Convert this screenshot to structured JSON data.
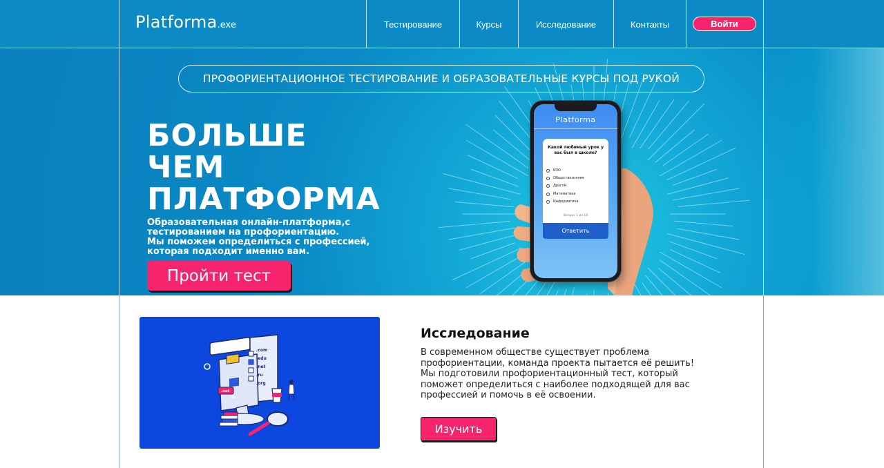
{
  "header": {
    "logo_main": "Platforma",
    "logo_suffix": ".exe",
    "nav": [
      {
        "label": "Тестирование"
      },
      {
        "label": "Курсы"
      },
      {
        "label": "Исследование"
      },
      {
        "label": "Контакты"
      }
    ],
    "login_label": "Войти"
  },
  "hero": {
    "pill_text": "ПРОФОРИЕНТАЦИОННОЕ ТЕСТИРОВАНИЕ И ОБРАЗОВАТЕЛЬНЫЕ КУРСЫ ПОД РУКОЙ",
    "headline": [
      "БОЛЬШЕ",
      "ЧЕМ",
      "ПЛАТФОРМА"
    ],
    "description": [
      "Образовательная онлайн-платформа,с",
      "тестированием на профориентацию.",
      "Мы поможем определиться с профессией,",
      "которая подходит именно вам."
    ],
    "cta_label": "Пройти тест"
  },
  "phone": {
    "app_title": "Platforma",
    "question": "Какой любимый урок у вас был в школе?",
    "options": [
      "ИЗО",
      "Обществознание",
      "Другой",
      "Математика",
      "Информатика"
    ],
    "counter": "Вопрос 1 из 18",
    "answer_label": "Ответить"
  },
  "research": {
    "title": "Исследование",
    "text": [
      "В современном обществе существует проблема",
      "профориентации, команда проекта пытается её решить!",
      "Мы подготовили профориентационный тест, который",
      "поможет определиться с наиболее подходящей для вас",
      "профессией и помочь в её освоении."
    ],
    "button_label": "Изучить",
    "illustration_tags": [
      ".com",
      ".edu",
      ".net",
      ".ru",
      ".org",
      ".net",
      "in"
    ]
  },
  "colors": {
    "header_bg": "#0b8ac5",
    "accent_pink": "#f5246d",
    "illustration_bg": "#0c48df"
  }
}
